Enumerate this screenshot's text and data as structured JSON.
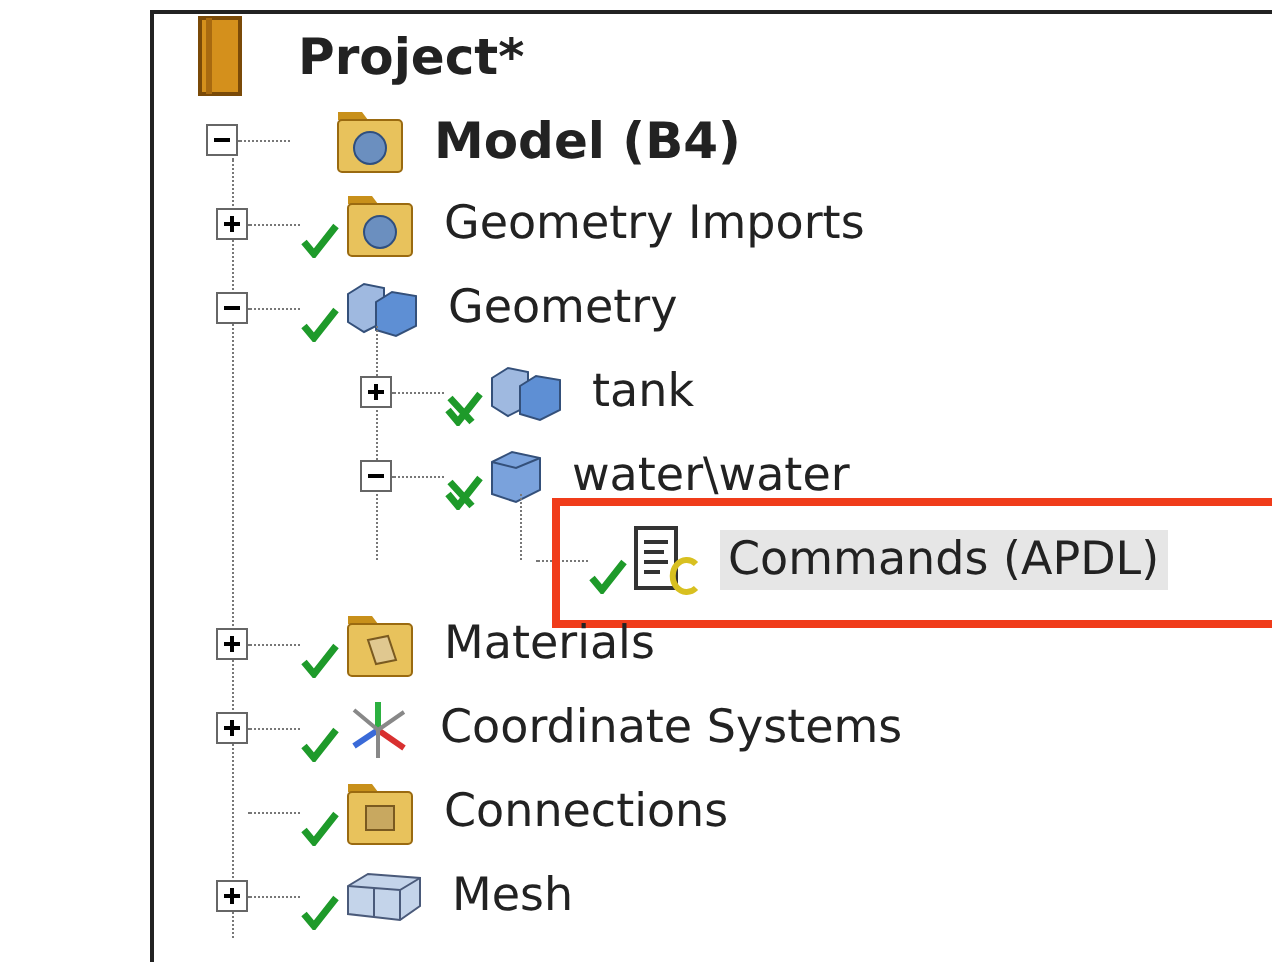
{
  "tree": {
    "label": "Project*",
    "kind": "project",
    "children": [
      {
        "label": "Model (B4)",
        "kind": "model",
        "expanded": true,
        "children": [
          {
            "label": "Geometry Imports",
            "kind": "imports",
            "expanded": false,
            "checked": true,
            "crossed": false
          },
          {
            "label": "Geometry",
            "kind": "geometry",
            "expanded": true,
            "checked": true,
            "crossed": false,
            "children": [
              {
                "label": "tank",
                "kind": "body-group",
                "expanded": false,
                "checked": true,
                "crossed": true
              },
              {
                "label": "water\\water",
                "kind": "body",
                "expanded": true,
                "checked": true,
                "crossed": true,
                "children": [
                  {
                    "label": "Commands (APDL)",
                    "kind": "commands",
                    "checked": true,
                    "crossed": false,
                    "selected": true,
                    "annotated": true
                  }
                ]
              }
            ]
          },
          {
            "label": "Materials",
            "kind": "materials",
            "expanded": false,
            "checked": true,
            "crossed": false
          },
          {
            "label": "Coordinate Systems",
            "kind": "coordinates",
            "expanded": false,
            "checked": true,
            "crossed": false
          },
          {
            "label": "Connections",
            "kind": "connections",
            "checked": true,
            "crossed": false
          },
          {
            "label": "Mesh",
            "kind": "mesh",
            "expanded": false,
            "checked": true,
            "crossed": false
          }
        ]
      }
    ]
  }
}
